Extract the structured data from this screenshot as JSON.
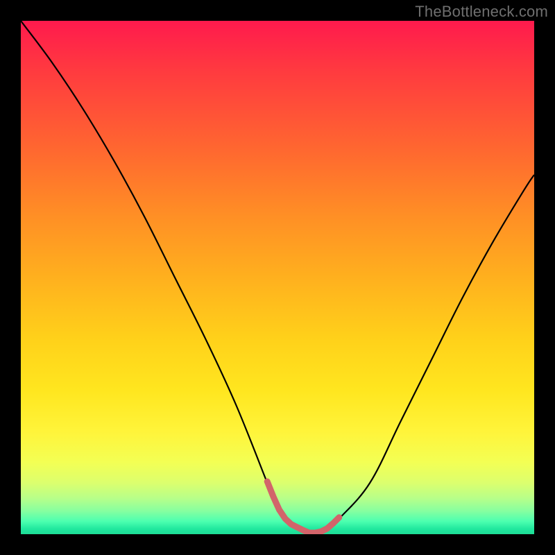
{
  "watermark": "TheBottleneck.com",
  "colors": {
    "frame": "#000000",
    "curve": "#000000",
    "bottom_marker": "#d2646a",
    "gradient_top": "#ff1a4d",
    "gradient_bottom": "#1edc96"
  },
  "chart_data": {
    "type": "line",
    "title": "",
    "xlabel": "",
    "ylabel": "",
    "xlim": [
      0,
      100
    ],
    "ylim": [
      0,
      100
    ],
    "series": [
      {
        "name": "bottleneck-curve",
        "x": [
          0,
          6,
          12,
          18,
          24,
          30,
          36,
          42,
          48,
          50,
          52,
          54,
          56,
          58,
          60,
          62,
          68,
          74,
          80,
          86,
          92,
          98,
          100
        ],
        "values": [
          100,
          92,
          83,
          73,
          62,
          50,
          38,
          25,
          10,
          5,
          2,
          1,
          0,
          0,
          1,
          3,
          10,
          22,
          34,
          46,
          57,
          67,
          70
        ]
      }
    ],
    "annotations": [
      {
        "name": "valley-marker",
        "x_start": 48,
        "x_end": 62,
        "y": 1.5
      }
    ]
  }
}
